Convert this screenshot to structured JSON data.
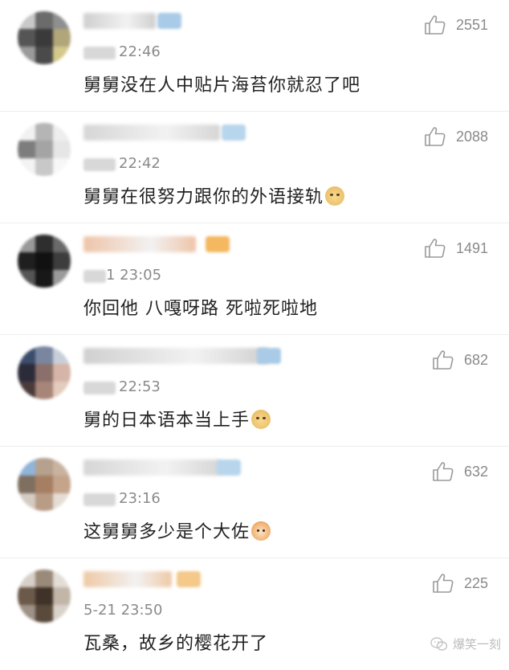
{
  "comments": [
    {
      "timestamp": "22:46",
      "text": "舅舅没在人中贴片海苔你就忍了吧",
      "emoji": null,
      "likes": "2551",
      "avatar_colors": [
        "#c9c9c9",
        "#6b6b6b",
        "#8f8f8f",
        "#555555",
        "#3a3a3a",
        "#b0a67a",
        "#9a9a9a",
        "#4a4a4a",
        "#d4c98b"
      ],
      "username_color": "#cfcfcf",
      "badge_color": "#a9cbe8"
    },
    {
      "timestamp": "22:42",
      "text": "舅舅在很努力跟你的外语接轨",
      "emoji": "doge-emoji",
      "likes": "2088",
      "avatar_colors": [
        "#f1f1f1",
        "#b5b5b5",
        "#eeeeee",
        "#7d7d7d",
        "#a4a4a4",
        "#e6e6e6",
        "#f3f3f3",
        "#c8c8c8",
        "#f7f7f7"
      ],
      "username_color": "#d6d6d6",
      "badge_color": "#b7d5ec"
    },
    {
      "timestamp": "1 23:05",
      "text": "你回他 八嘎呀路 死啦死啦地",
      "emoji": null,
      "likes": "1491",
      "avatar_colors": [
        "#9a9a9a",
        "#2e2e2e",
        "#6a6a6a",
        "#1f1f1f",
        "#111111",
        "#3d3d3d",
        "#555555",
        "#181818",
        "#9b9b9b"
      ],
      "username_color": "#eec4a8",
      "badge_color": "#f4b860"
    },
    {
      "timestamp": "22:53",
      "text": "舅的日本语本当上手",
      "emoji": "doge-emoji",
      "likes": "682",
      "avatar_colors": [
        "#3b4d6b",
        "#7a86a0",
        "#c9cfd9",
        "#2c2b3a",
        "#8b6f6a",
        "#d6b5a8",
        "#4a3b3a",
        "#a78578",
        "#e3cbbd"
      ],
      "username_color": "#d0d0d0",
      "badge_color": "#a9cbe8"
    },
    {
      "timestamp": "23:16",
      "text": "这舅舅多少是个大佐",
      "emoji": "cat-emoji",
      "likes": "632",
      "avatar_colors": [
        "#8fb5d9",
        "#b6a08e",
        "#c9b3a0",
        "#7f6f60",
        "#a67f63",
        "#c4a48a",
        "#d4cbc3",
        "#b89c86",
        "#e5ddd5"
      ],
      "username_color": "#d6d6d6",
      "badge_color": "#b7d5ec"
    },
    {
      "timestamp": "5-21 23:50",
      "text": "瓦桑，故乡的樱花开了",
      "emoji": null,
      "likes": "225",
      "avatar_colors": [
        "#d6d0c8",
        "#9a8a7a",
        "#e3ddd6",
        "#6b5a4a",
        "#3f3228",
        "#c2b6a8",
        "#9e9185",
        "#5a4a3c",
        "#d9d2ca"
      ],
      "username_color": "#efc9a6",
      "badge_color": "#f4c98a"
    }
  ],
  "watermark": {
    "text": "爆笑一刻",
    "icon": "wechat-icon"
  },
  "colors": {
    "text": "#222222",
    "meta": "#8a8a8a",
    "divider": "#eeeeee"
  }
}
